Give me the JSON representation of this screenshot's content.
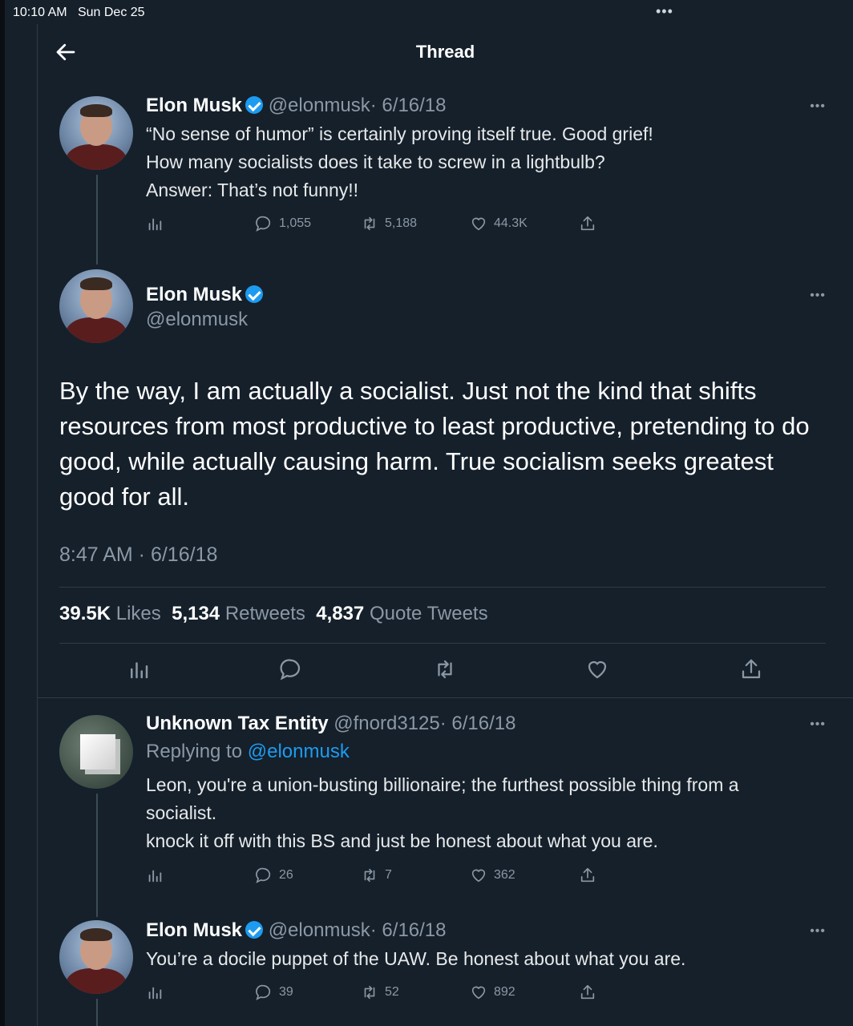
{
  "status": {
    "time": "10:10 AM",
    "date": "Sun Dec 25",
    "dots": "•••"
  },
  "header": {
    "title": "Thread"
  },
  "tweet1": {
    "name": "Elon Musk",
    "handle": "@elonmusk",
    "date": "· 6/16/18",
    "lines": [
      "“No sense of humor” is certainly proving itself true. Good grief!",
      "How many socialists does it take to screw in a lightbulb?",
      "Answer: That’s not funny!!"
    ],
    "replies": "1,055",
    "retweets": "5,188",
    "likes": "44.3K"
  },
  "main": {
    "name": "Elon Musk",
    "handle": "@elonmusk",
    "text": "By the way, I am actually a socialist. Just not the kind that shifts resources from most productive to least productive, pretending to do good, while actually causing harm. True socialism seeks greatest good for all.",
    "time": "8:47 AM · 6/16/18",
    "likes_count": "39.5K",
    "likes_label": "Likes",
    "retweets_count": "5,134",
    "retweets_label": "Retweets",
    "quotes_count": "4,837",
    "quotes_label": "Quote Tweets"
  },
  "reply1": {
    "name": "Unknown Tax Entity",
    "handle": "@fnord3125",
    "date": "· 6/16/18",
    "replying_prefix": "Replying to",
    "replying_handle": "@elonmusk",
    "lines": [
      "Leon, you're a union-busting billionaire; the furthest possible thing from a",
      "socialist.",
      "knock it off with this BS and just be honest about what you are."
    ],
    "replies": "26",
    "retweets": "7",
    "likes": "362"
  },
  "reply2": {
    "name": "Elon Musk",
    "handle": "@elonmusk",
    "date": "· 6/16/18",
    "text": "You’re a docile puppet of the UAW. Be honest about what you are.",
    "replies": "39",
    "retweets": "52",
    "likes": "892"
  },
  "more_label": "•••",
  "colors": {
    "background": "#15202b",
    "accent": "#1d9bf0",
    "muted": "#8b98a5"
  },
  "icons": [
    "back-arrow-icon",
    "verified-badge-icon",
    "more-icon",
    "analytics-icon",
    "reply-icon",
    "retweet-icon",
    "like-icon",
    "share-icon"
  ]
}
